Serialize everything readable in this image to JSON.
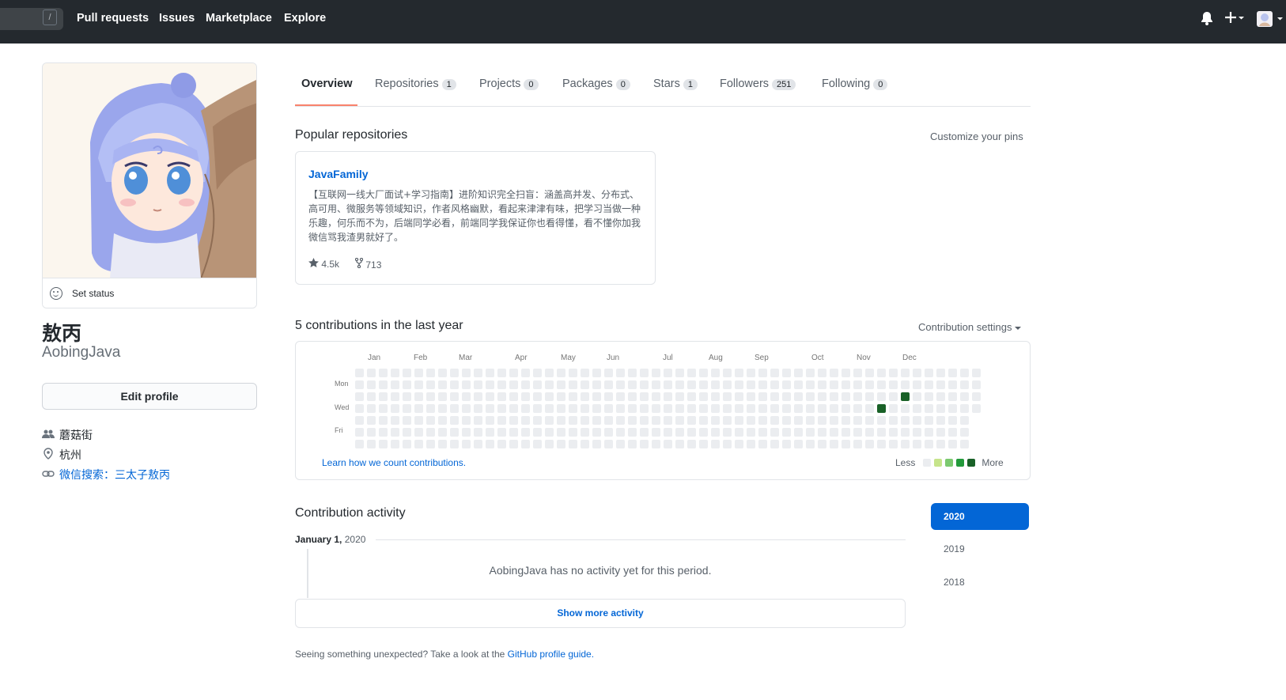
{
  "header": {
    "search_key": "/",
    "nav": [
      "Pull requests",
      "Issues",
      "Marketplace",
      "Explore"
    ],
    "icons": [
      "bell-icon",
      "plus-icon",
      "avatar-menu"
    ]
  },
  "profile": {
    "set_status": "Set status",
    "fullname": "敖丙",
    "username": "AobingJava",
    "edit_profile": "Edit profile",
    "company": "蘑菇街",
    "location": "杭州",
    "website": "微信搜索：三太子敖丙"
  },
  "tabs": [
    {
      "label": "Overview",
      "count": ""
    },
    {
      "label": "Repositories",
      "count": "1"
    },
    {
      "label": "Projects",
      "count": "0"
    },
    {
      "label": "Packages",
      "count": "0"
    },
    {
      "label": "Stars",
      "count": "1"
    },
    {
      "label": "Followers",
      "count": "251"
    },
    {
      "label": "Following",
      "count": "0"
    }
  ],
  "popular": {
    "title": "Popular repositories",
    "customize": "Customize your pins",
    "repo": {
      "name": "JavaFamily",
      "description": "【互联网一线大厂面试+学习指南】进阶知识完全扫盲：涵盖高并发、分布式、高可用、微服务等领域知识，作者风格幽默，看起来津津有味，把学习当做一种乐趣，何乐而不为，后端同学必看，前端同学我保证你也看得懂，看不懂你加我微信骂我渣男就好了。",
      "stars": "4.5k",
      "forks": "713"
    }
  },
  "contributions": {
    "title": "5 contributions in the last year",
    "settings": "Contribution settings",
    "months": [
      "Jan",
      "Feb",
      "Mar",
      "Apr",
      "May",
      "Jun",
      "Jul",
      "Aug",
      "Sep",
      "Oct",
      "Nov",
      "Dec"
    ],
    "weekdays": [
      "Mon",
      "Wed",
      "Fri"
    ],
    "learn_link": "Learn how we count contributions.",
    "legend_less": "Less",
    "legend_more": "More",
    "colors": [
      "#ebedf0",
      "#c6e48b",
      "#7bc96f",
      "#239a3b",
      "#196127"
    ]
  },
  "activity": {
    "title": "Contribution activity",
    "date_month": "January 1,",
    "date_year": "2020",
    "empty": "AobingJava has no activity yet for this period.",
    "show_more": "Show more activity",
    "footnote_prefix": "Seeing something unexpected? Take a look at the",
    "footnote_link": "GitHub profile guide.",
    "years": [
      "2020",
      "2019",
      "2018"
    ]
  }
}
